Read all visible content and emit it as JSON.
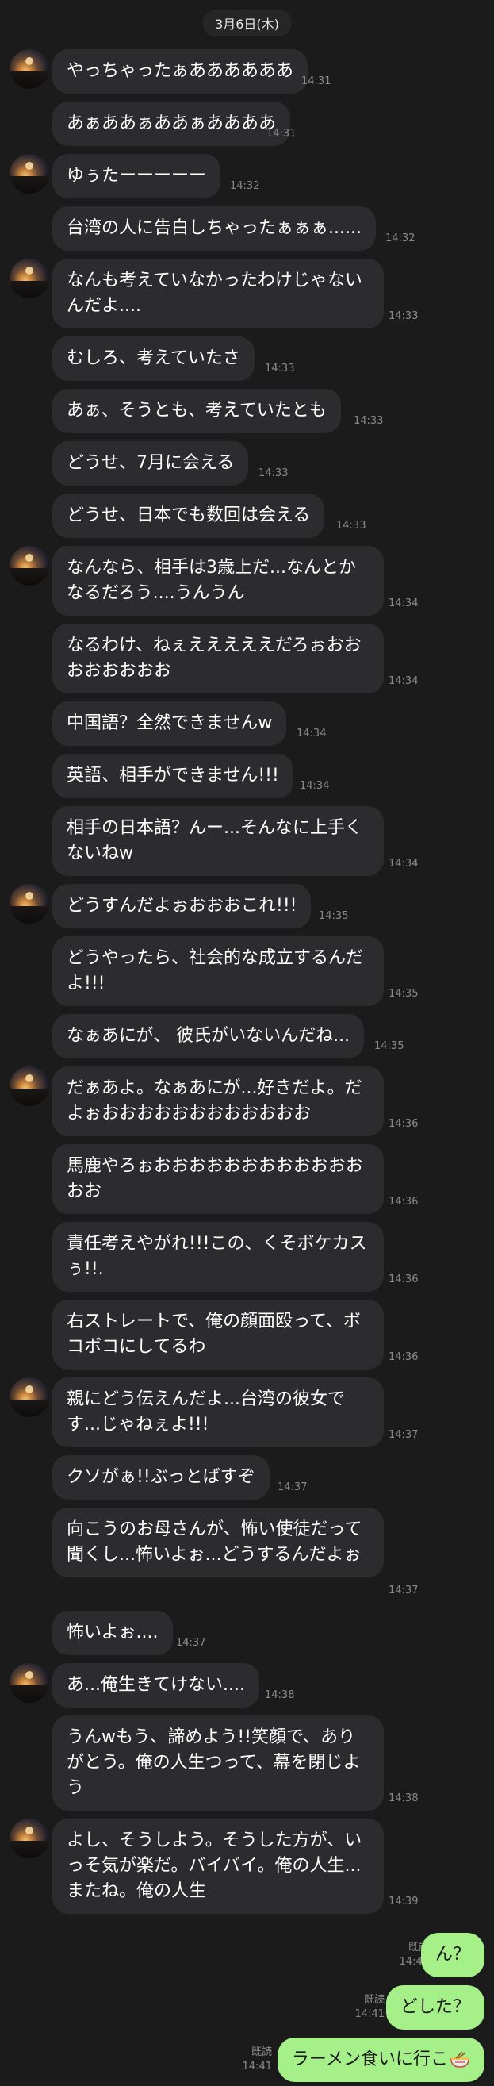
{
  "date_label": "3月6日(木)",
  "incoming": [
    {
      "text": "やっちゃったぁああああああ",
      "time": "14:31",
      "avatar": true
    },
    {
      "text": "あぁああぁああぁああああ",
      "time": "14:31",
      "avatar": false
    },
    {
      "text": "ゆぅたーーーーー",
      "time": "14:32",
      "avatar": true
    },
    {
      "text": "台湾の人に告白しちゃったぁぁぁ......",
      "time": "14:32",
      "avatar": false
    },
    {
      "text": "なんも考えていなかったわけじゃないんだよ....",
      "time": "14:33",
      "avatar": true
    },
    {
      "text": "むしろ、考えていたさ",
      "time": "14:33",
      "avatar": false
    },
    {
      "text": "あぁ、そうとも、考えていたとも",
      "time": "14:33",
      "avatar": false
    },
    {
      "text": "どうせ、7月に会える",
      "time": "14:33",
      "avatar": false
    },
    {
      "text": "どうせ、日本でも数回は会える",
      "time": "14:33",
      "avatar": false
    },
    {
      "text": "なんなら、相手は3歳上だ...なんとかなるだろう....うんうん",
      "time": "14:34",
      "avatar": true
    },
    {
      "text": "なるわけ、ねぇえええええだろぉおおおおおおおお",
      "time": "14:34",
      "avatar": false
    },
    {
      "text": "中国語？全然できませんw",
      "time": "14:34",
      "avatar": false
    },
    {
      "text": "英語、相手ができません!!!",
      "time": "14:34",
      "avatar": false
    },
    {
      "text": "相手の日本語？んー...そんなに上手くないねw",
      "time": "14:34",
      "avatar": false
    },
    {
      "text": "どうすんだよぉおおおこれ!!!",
      "time": "14:35",
      "avatar": true
    },
    {
      "text": "どうやったら、社会的な成立するんだよ!!!",
      "time": "14:35",
      "avatar": false
    },
    {
      "text": "なぁあにが、 彼氏がいないんだね...",
      "time": "14:35",
      "avatar": false
    },
    {
      "text": "だぁあよ。なぁあにが...好きだよ。だよぉおおおおおおおおおおおお",
      "time": "14:36",
      "avatar": true
    },
    {
      "text": "馬鹿やろぉおおおおおおおおおおおおおお",
      "time": "14:36",
      "avatar": false
    },
    {
      "text": "責任考えやがれ!!!この、くそボケカスぅ!!.",
      "time": "14:36",
      "avatar": false
    },
    {
      "text": "右ストレートで、俺の顔面殴って、ボコボコにしてるわ",
      "time": "14:36",
      "avatar": false
    },
    {
      "text": "親にどう伝えんだよ...台湾の彼女です...じゃねぇよ!!!",
      "time": "14:37",
      "avatar": true
    },
    {
      "text": "クソがぁ!!ぶっとばすぞ",
      "time": "14:37",
      "avatar": false
    },
    {
      "text": "向こうのお母さんが、怖い使徒だって聞くし...怖いよぉ...どうするんだよぉ",
      "time": "14:37",
      "avatar": false
    },
    {
      "text": "怖いよぉ....",
      "time": "14:37",
      "avatar": false
    },
    {
      "text": "あ...俺生きてけない....",
      "time": "14:38",
      "avatar": true
    },
    {
      "text": "うんwもう、諦めよう!!笑顔で、ありがとう。俺の人生つって、幕を閉じよう",
      "time": "14:38",
      "avatar": false
    },
    {
      "text": "よし、そうしよう。そうした方が、いっそ気が楽だ。バイバイ。俺の人生...またね。俺の人生",
      "time": "14:39",
      "avatar": true
    }
  ],
  "outgoing": [
    {
      "text": "ん？",
      "read": "既読",
      "time": "14:41",
      "icon": ""
    },
    {
      "text": "どした？",
      "read": "既読",
      "time": "14:41",
      "icon": ""
    },
    {
      "text": "ラーメン食いに行こ",
      "read": "既読",
      "time": "14:41",
      "icon": "ramen-icon"
    }
  ],
  "colors": {
    "background": "#1b1b1b",
    "incoming_bubble": "#2c2c2e",
    "outgoing_bubble": "#a6f08a",
    "timestamp": "#8a8a8a"
  }
}
